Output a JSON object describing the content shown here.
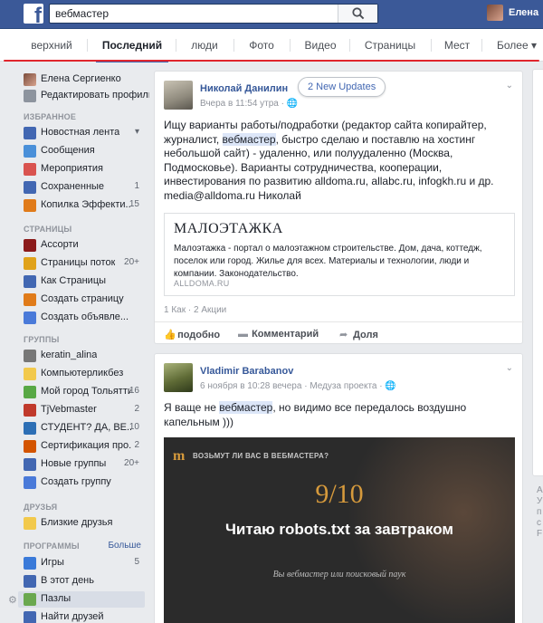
{
  "topbar": {
    "logo_letter": "f",
    "search_value": "вебмастер",
    "user_name": "Елена"
  },
  "tabs": [
    "верхний",
    "Последний",
    "люди",
    "Фото",
    "Видео",
    "Страницы",
    "Мест",
    "Более ▾"
  ],
  "sidebar": {
    "profile_name": "Елена Сергиенко",
    "edit_profile": "Редактировать профиль",
    "favorites_heading": "ИЗБРАННОЕ",
    "favorites": [
      {
        "label": "Новостная лента",
        "count": "▾",
        "color": "#4267b2"
      },
      {
        "label": "Сообщения",
        "count": "",
        "color": "#4a90d9"
      },
      {
        "label": "Мероприятия",
        "count": "",
        "color": "#d9534f"
      },
      {
        "label": "Сохраненные",
        "count": "1",
        "color": "#4267b2"
      },
      {
        "label": "Копилка Эффекти...",
        "count": "15",
        "color": "#e07b1a"
      }
    ],
    "pages_heading": "СТРАНИЦЫ",
    "pages": [
      {
        "label": "Ассорти",
        "count": "",
        "color": "#8b1a1a"
      },
      {
        "label": "Страницы поток",
        "count": "20+",
        "color": "#e0a21a"
      },
      {
        "label": "Как Страницы",
        "count": "",
        "color": "#4267b2"
      },
      {
        "label": "Создать страницу",
        "count": "",
        "color": "#e07b1a"
      },
      {
        "label": "Создать объявле...",
        "count": "",
        "color": "#4a7ad9"
      }
    ],
    "groups_heading": "ГРУППЫ",
    "groups": [
      {
        "label": "keratin_alina",
        "count": "",
        "color": "#777777"
      },
      {
        "label": "Компьютерликбез",
        "count": "",
        "color": "#f2c94c"
      },
      {
        "label": "Мой город Тольятти",
        "count": "16",
        "color": "#58a845"
      },
      {
        "label": "TjVebmaster",
        "count": "2",
        "color": "#c0392b"
      },
      {
        "label": "СТУДЕНТ? ДА, ВЕ...",
        "count": "10",
        "color": "#2d6fb5"
      },
      {
        "label": "Сертификация про...",
        "count": "2",
        "color": "#d35400"
      },
      {
        "label": "Новые группы",
        "count": "20+",
        "color": "#4267b2"
      },
      {
        "label": "Создать группу",
        "count": "",
        "color": "#4a7ad9"
      }
    ],
    "friends_heading": "ДРУЗЬЯ",
    "friends": [
      {
        "label": "Близкие друзья",
        "count": "",
        "color": "#f2c94c"
      }
    ],
    "apps_heading": "ПРОГРАММЫ",
    "apps_more": "Больше",
    "apps": [
      {
        "label": "Игры",
        "count": "5",
        "color": "#3a7ad9"
      },
      {
        "label": "В этот день",
        "count": "",
        "color": "#4267b2"
      },
      {
        "label": "Пазлы",
        "count": "",
        "color": "#6aa84f"
      },
      {
        "label": "Найти друзей",
        "count": "",
        "color": "#4267b2"
      }
    ]
  },
  "post1": {
    "author": "Николай Данилин",
    "new_updates": "2 New Updates",
    "meta": "Вчера в 11:54 утра · 🌐",
    "text_before": "Ищу варианты работы/подработки (редактор сайта копирайтер, журналист, ",
    "text_highlight": "вебмастер",
    "text_after": ", быстро сделаю и поставлю на хостинг небольшой сайт) - удаленно, или полуудаленно (Москва, Подмосковье). Варианты сотрудничества, кооперации, инвестирования по развитию alldoma.ru, allabc.ru, infogkh.ru и др. media@alldoma.ru Николай",
    "link_title": "МАЛОЭТАЖКА",
    "link_desc": "Малоэтажка - портал о малоэтажном строительстве. Дом, дача, коттедж, поселок или город. Жилье для всех. Материалы и технологии, люди и компании. Законодательство.",
    "link_domain": "ALLDOMA.RU",
    "counts": "1 Как · 2 Акции",
    "like": "подобно",
    "comment": "Комментарий",
    "share": "Доля"
  },
  "post2": {
    "author": "Vladimir Barabanov",
    "meta": "6 ноября в 10:28 вечера · Медуза проекта · 🌐",
    "text_before": "Я ваще не ",
    "text_highlight": "вебмастер",
    "text_after": ", но видимо все передалось воздушно капельным )))",
    "promo_logo": "m",
    "promo_top": "ВОЗЬМУТ ЛИ ВАС В ВЕБМАСТЕРА?",
    "promo_score": "9/10",
    "promo_headline": "Читаю robots.txt за завтраком",
    "promo_sub": "Вы вебмастер или поисковый паук"
  },
  "right_letters": [
    "A",
    "У",
    "п",
    "с",
    "F"
  ]
}
